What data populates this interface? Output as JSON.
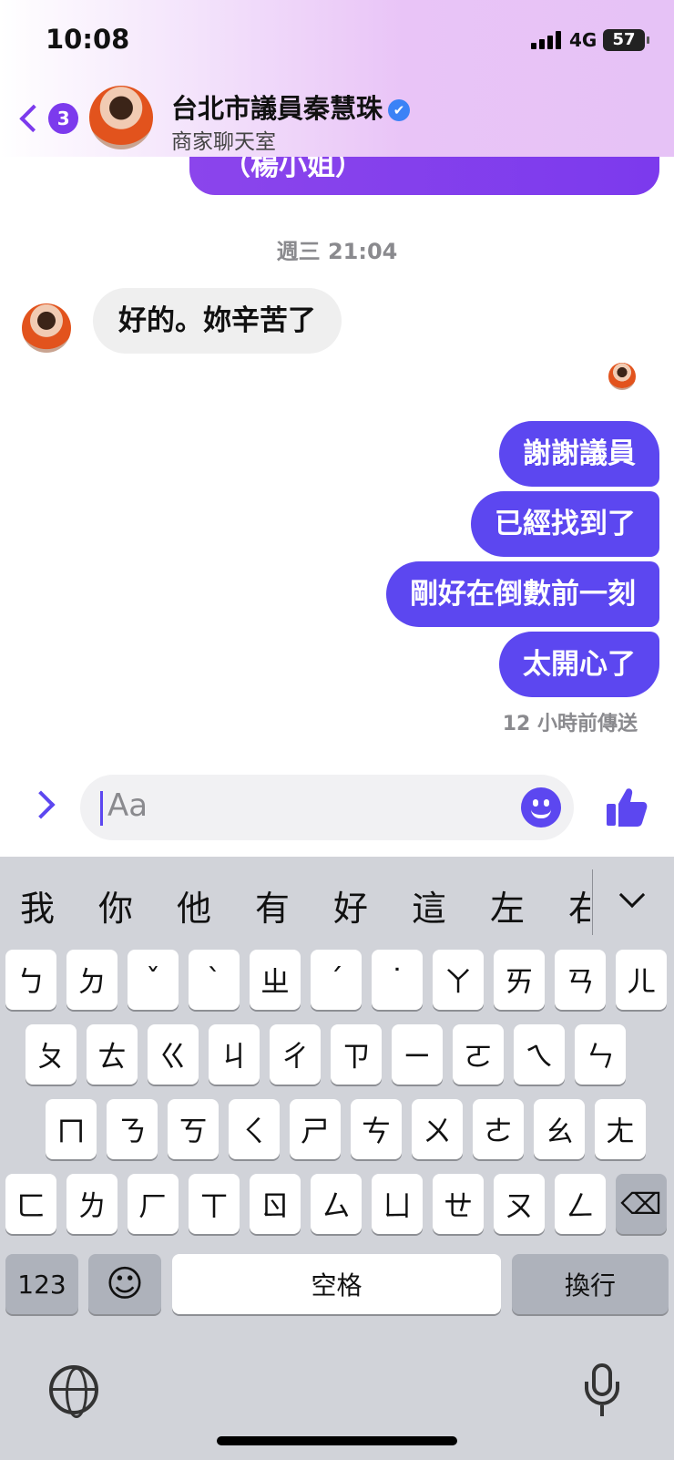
{
  "status_bar": {
    "time": "10:08",
    "network": "4G",
    "battery": "57"
  },
  "header": {
    "unread_count": "3",
    "name": "台北市議員秦慧珠",
    "verified": "✔",
    "subtitle": "商家聊天室"
  },
  "chat": {
    "partial_bubble": "（楊小姐）",
    "timestamp": "週三 21:04",
    "incoming": [
      {
        "text": "好的。妳辛苦了"
      }
    ],
    "outgoing": [
      {
        "text": "謝謝議員"
      },
      {
        "text": "已經找到了"
      },
      {
        "text": "剛好在倒數前一刻"
      },
      {
        "text": "太開心了"
      }
    ],
    "sent_status": "12 小時前傳送"
  },
  "composer": {
    "placeholder": "Aa",
    "expand_icon": "chevron-right-icon",
    "emoji_icon": "smiley-icon",
    "like_icon": "thumbs-up-icon"
  },
  "keyboard": {
    "suggestions": [
      "我",
      "你",
      "他",
      "有",
      "好",
      "這",
      "左",
      "右"
    ],
    "row1": [
      "ㄅ",
      "ㄉ",
      "ˇ",
      "ˋ",
      "ㄓ",
      "ˊ",
      "˙",
      "ㄚ",
      "ㄞ",
      "ㄢ",
      "ㄦ"
    ],
    "row2": [
      "ㄆ",
      "ㄊ",
      "ㄍ",
      "ㄐ",
      "ㄔ",
      "ㄗ",
      "ㄧ",
      "ㄛ",
      "ㄟ",
      "ㄣ"
    ],
    "row3": [
      "ㄇ",
      "ㄋ",
      "ㄎ",
      "ㄑ",
      "ㄕ",
      "ㄘ",
      "ㄨ",
      "ㄜ",
      "ㄠ",
      "ㄤ"
    ],
    "row4": [
      "ㄈ",
      "ㄌ",
      "ㄏ",
      "ㄒ",
      "ㄖ",
      "ㄙ",
      "ㄩ",
      "ㄝ",
      "ㄡ",
      "ㄥ"
    ],
    "backspace": "⌫",
    "numbers_key": "123",
    "emoji_key": "☺",
    "space_key": "空格",
    "return_key": "換行"
  },
  "colors": {
    "accent": "#5c47f0",
    "header_purple": "#7c3aed"
  }
}
